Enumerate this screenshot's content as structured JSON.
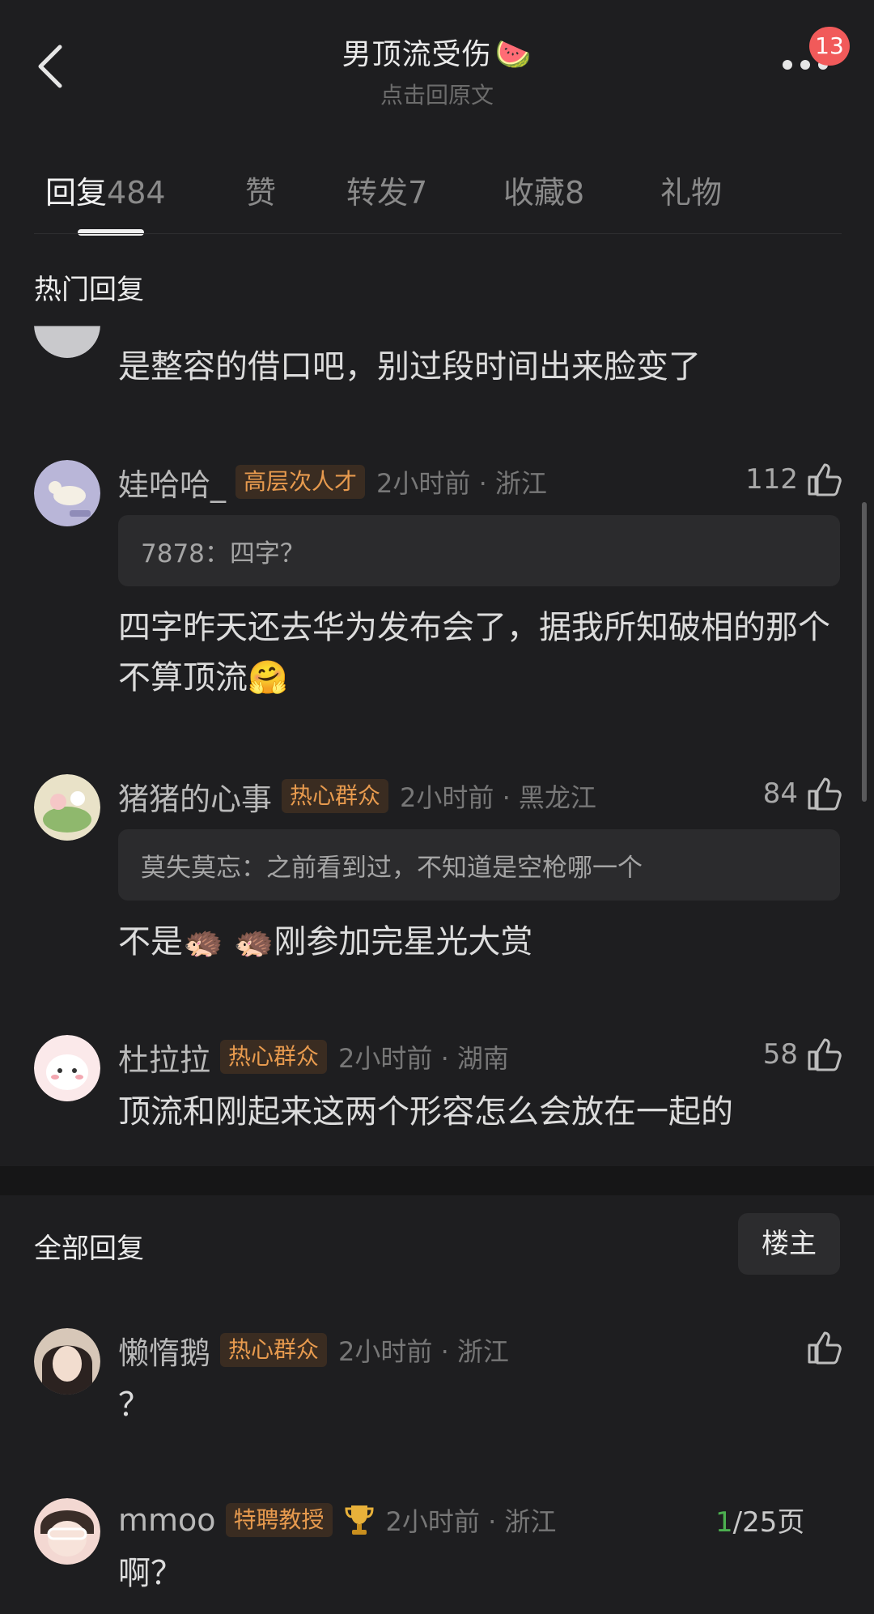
{
  "header": {
    "title": "男顶流受伤",
    "title_emoji": "🍉",
    "subtitle": "点击回原文",
    "badge_count": "13"
  },
  "tabs": [
    {
      "label": "回复",
      "count": "484",
      "active": true
    },
    {
      "label": "赞",
      "count": ""
    },
    {
      "label": "转发",
      "count": "7"
    },
    {
      "label": "收藏",
      "count": "8"
    },
    {
      "label": "礼物",
      "count": ""
    }
  ],
  "hot": {
    "title": "热门回复",
    "partial_comment": "是整容的借口吧，别过段时间出来脸变了",
    "comments": [
      {
        "name": "娃哈哈_",
        "tag": "高层次人才",
        "meta": "2小时前 · 浙江",
        "likes": "112",
        "quote": "7878：四字？",
        "text": "四字昨天还去华为发布会了，据我所知破相的那个不算顶流🤗"
      },
      {
        "name": "猪猪的心事",
        "tag": "热心群众",
        "meta": "2小时前 · 黑龙江",
        "likes": "84",
        "quote": "莫失莫忘：之前看到过，不知道是空枪哪一个",
        "text": "不是🦔 🦔刚参加完星光大赏"
      },
      {
        "name": "杜拉拉",
        "tag": "热心群众",
        "meta": "2小时前 · 湖南",
        "likes": "58",
        "text": "顶流和刚起来这两个形容怎么会放在一起的"
      }
    ]
  },
  "all": {
    "title": "全部回复",
    "owner_button": "楼主",
    "comments": [
      {
        "name": "懒惰鹅",
        "tag": "热心群众",
        "meta": "2小时前 · 浙江",
        "text": "？"
      },
      {
        "name": "mmoo",
        "tag": "特聘教授",
        "meta": "2小时前 · 浙江",
        "text": "啊？"
      }
    ]
  },
  "pagination": {
    "current": "1",
    "total": "/25页"
  },
  "colors": {
    "background": "#1e1e20",
    "tag_text": "#e79a4e",
    "tag_bg": "#3a2c21",
    "badge": "#f15a5a",
    "page_current": "#4caf50"
  },
  "icons": [
    "back-icon",
    "more-icon",
    "like-icon",
    "trophy-icon"
  ]
}
